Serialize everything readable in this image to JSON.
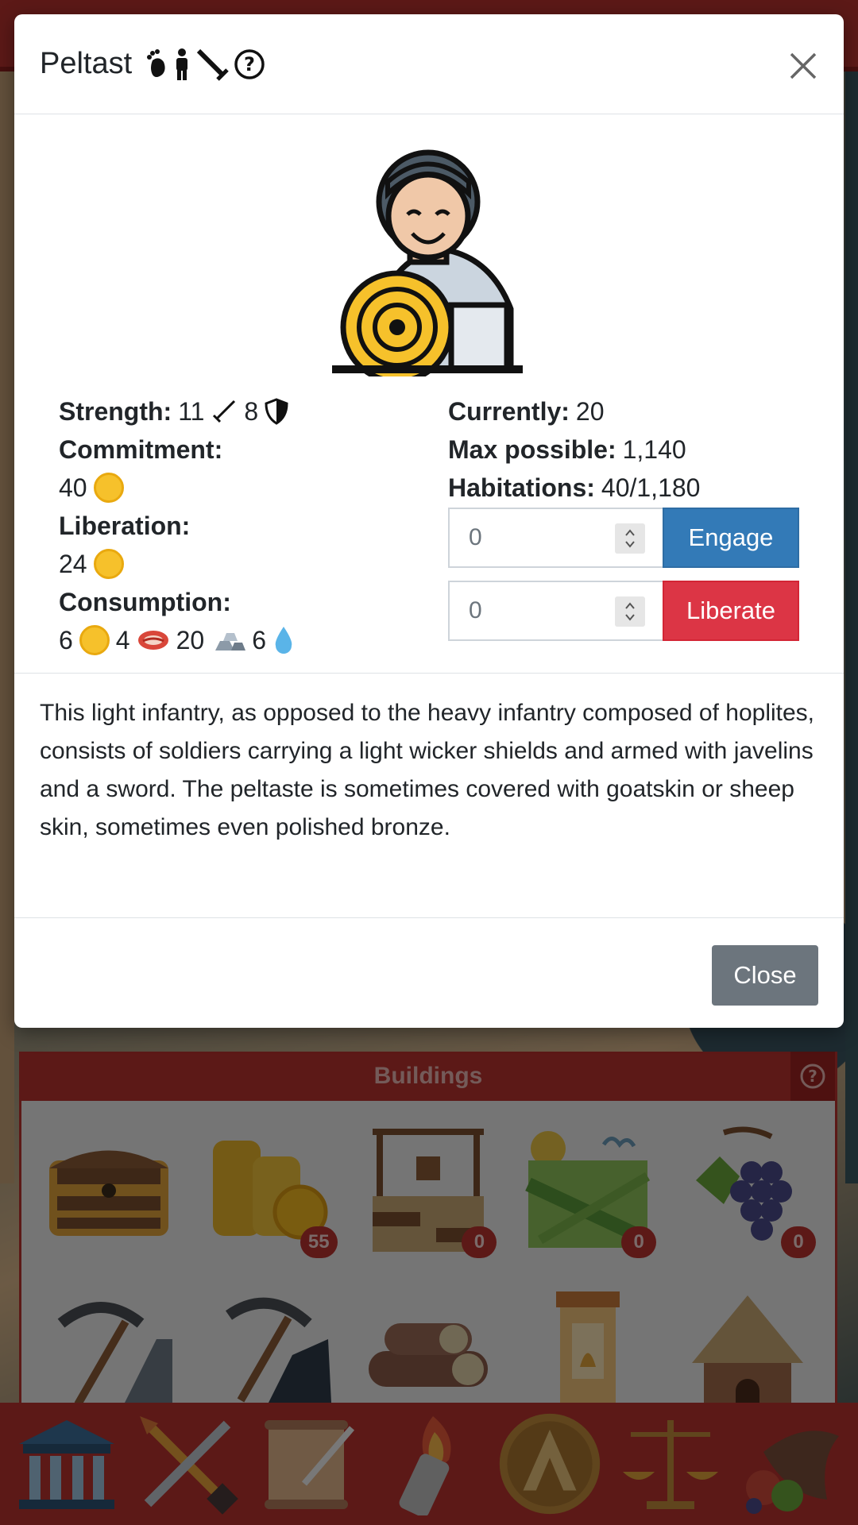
{
  "modal": {
    "title": "Peltast",
    "title_icons": [
      "footprint-icon",
      "person-icon",
      "sword-icon",
      "help-icon"
    ],
    "close_x": "×"
  },
  "stats": {
    "strength_label": "Strength:",
    "strength_attack": "11",
    "strength_defense": "8",
    "commitment_label": "Commitment:",
    "commitment_value": "40",
    "liberation_label": "Liberation:",
    "liberation_value": "24",
    "consumption_label": "Consumption:",
    "consumption_gold": "6",
    "consumption_meat": "4",
    "consumption_metal": "20",
    "consumption_water": "6",
    "currently_label": "Currently:",
    "currently_value": "20",
    "max_label": "Max possible:",
    "max_value": "1,140",
    "habitations_label": "Habitations:",
    "habitations_value": "40/1,180"
  },
  "actions": {
    "engage_input_value": "0",
    "engage_label": "Engage",
    "liberate_input_value": "0",
    "liberate_label": "Liberate"
  },
  "description": "This light infantry, as opposed to the heavy infantry composed of hoplites, consists of soldiers carrying a light wicker shields and armed with javelins and a sword. The peltaste is sometimes covered with goatskin or sheep skin, sometimes even polished bronze.",
  "footer": {
    "close_label": "Close"
  },
  "buildings": {
    "title": "Buildings",
    "items": [
      {
        "name": "treasure-chest",
        "badge": ""
      },
      {
        "name": "gold-coins",
        "badge": "55"
      },
      {
        "name": "well",
        "badge": "0"
      },
      {
        "name": "vineyard-field",
        "badge": "0"
      },
      {
        "name": "grapes",
        "badge": "0"
      },
      {
        "name": "pickaxe-stone",
        "badge": ""
      },
      {
        "name": "pickaxe-coal",
        "badge": ""
      },
      {
        "name": "logs",
        "badge": ""
      },
      {
        "name": "bell-tower",
        "badge": ""
      },
      {
        "name": "hut",
        "badge": ""
      }
    ]
  },
  "nav": [
    "temple-icon",
    "crossed-swords-icon",
    "scroll-icon",
    "torch-icon",
    "spartan-shield-icon",
    "scales-icon",
    "cornucopia-icon"
  ],
  "colors": {
    "primary_red": "#b8322e",
    "engage_blue": "#337ab7",
    "liberate_red": "#dc3545",
    "close_gray": "#6c757d"
  }
}
